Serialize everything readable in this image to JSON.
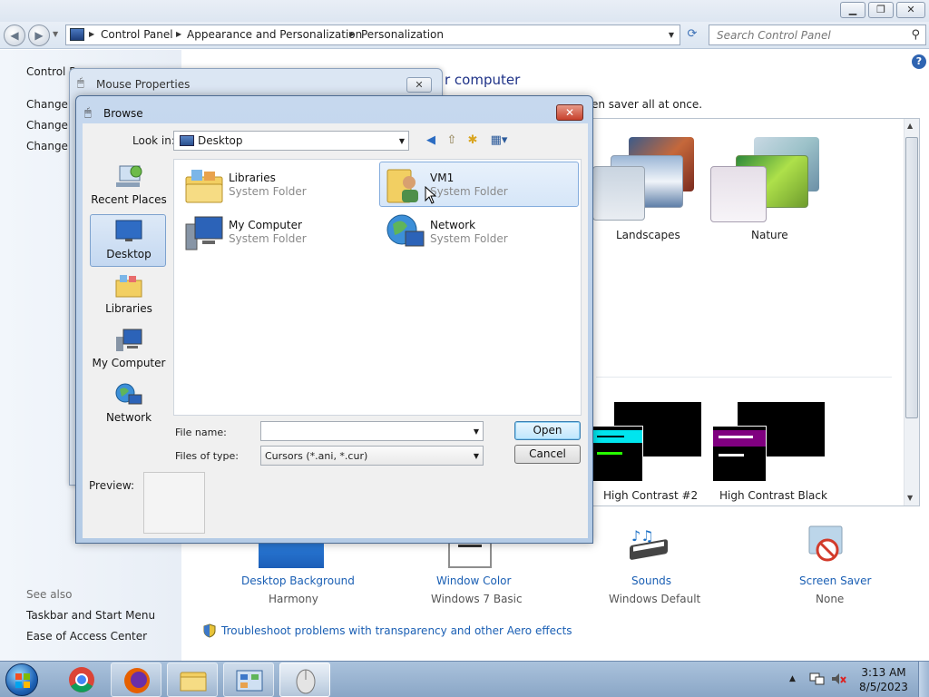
{
  "control_panel": {
    "breadcrumbs": [
      "Control Panel",
      "Appearance and Personalization",
      "Personalization"
    ],
    "search_placeholder": "Search Control Panel",
    "heading_fragment": "r computer",
    "subheading_fragment": "en saver all at once.",
    "sidebar": {
      "items": [
        "Control P",
        "Change",
        "Change",
        "Change"
      ],
      "see_also_label": "See also",
      "see_also_links": [
        "Taskbar and Start Menu",
        "Ease of Access Center"
      ]
    },
    "themes": [
      {
        "label": "Landscapes"
      },
      {
        "label": "Nature"
      },
      {
        "label": "High Contrast #2"
      },
      {
        "label": "High Contrast Black"
      }
    ],
    "bottom_items": [
      {
        "label": "Desktop Background",
        "sub": "Harmony"
      },
      {
        "label": "Window Color",
        "sub": "Windows 7 Basic"
      },
      {
        "label": "Sounds",
        "sub": "Windows Default"
      },
      {
        "label": "Screen Saver",
        "sub": "None"
      }
    ],
    "troubleshoot_link": "Troubleshoot problems with transparency and other Aero effects"
  },
  "mouse_properties": {
    "title": "Mouse Properties"
  },
  "browse_dialog": {
    "title": "Browse",
    "look_in_label": "Look in:",
    "look_in_value": "Desktop",
    "places": [
      {
        "label": "Recent Places",
        "icon": "recent-places-icon"
      },
      {
        "label": "Desktop",
        "icon": "desktop-icon",
        "selected": true
      },
      {
        "label": "Libraries",
        "icon": "libraries-icon"
      },
      {
        "label": "My Computer",
        "icon": "computer-icon"
      },
      {
        "label": "Network",
        "icon": "network-icon"
      }
    ],
    "files": [
      {
        "name": "Libraries",
        "type": "System Folder",
        "icon": "libraries-folder-icon"
      },
      {
        "name": "VM1",
        "type": "System Folder",
        "icon": "user-folder-icon"
      },
      {
        "name": "My Computer",
        "type": "System Folder",
        "icon": "computer-icon"
      },
      {
        "name": "Network",
        "type": "System Folder",
        "icon": "network-icon"
      }
    ],
    "file_name_label": "File name:",
    "file_name_value": "",
    "files_of_type_label": "Files of type:",
    "files_of_type_value": "Cursors (*.ani, *.cur)",
    "open_label": "Open",
    "cancel_label": "Cancel",
    "preview_label": "Preview:"
  },
  "taskbar": {
    "apps": [
      "chrome-icon",
      "firefox-icon",
      "explorer-icon",
      "control-panel-icon",
      "mouse-icon"
    ],
    "time": "3:13 AM",
    "date": "8/5/2023"
  },
  "colors": {
    "link_blue": "#1a5fb4",
    "heading_blue": "#1e3287",
    "hc_cyan": "#00e5ee",
    "hc_purple": "#800080"
  }
}
